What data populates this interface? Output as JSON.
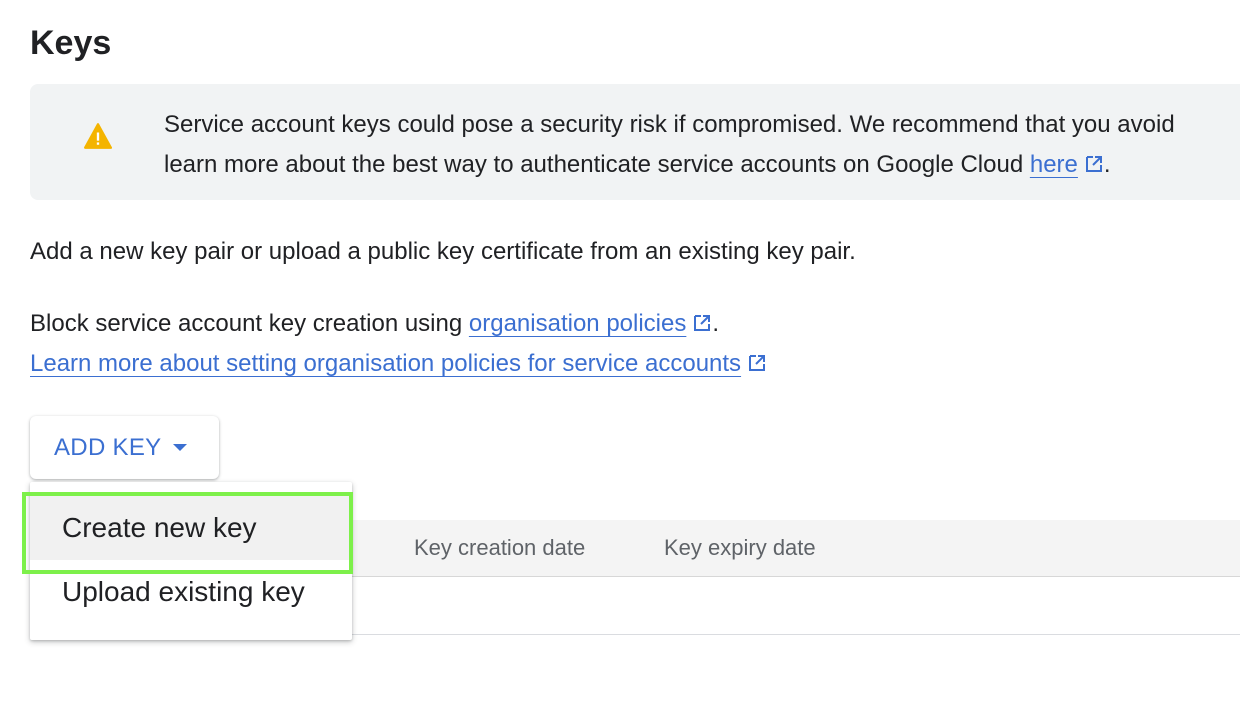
{
  "page": {
    "title": "Keys"
  },
  "warning": {
    "icon": "warning-icon",
    "icon_color": "#f4b400",
    "line1": "Service account keys could pose a security risk if compromised. We recommend that you avoid",
    "line2_prefix": "learn more about the best way to authenticate service accounts on Google Cloud ",
    "link_text": "here",
    "line2_suffix": "."
  },
  "description": "Add a new key pair or upload a public key certificate from an existing key pair.",
  "block": {
    "prefix": "Block service account key creation using ",
    "link_text": "organisation policies",
    "suffix": "."
  },
  "learn_more": {
    "link_text": "Learn more about setting organisation policies for service accounts"
  },
  "add_key": {
    "label": "ADD KEY"
  },
  "dropdown": {
    "items": [
      {
        "label": "Create new key"
      },
      {
        "label": "Upload existing key"
      }
    ]
  },
  "table": {
    "columns": [
      "Key creation date",
      "Key expiry date"
    ]
  },
  "colors": {
    "link": "#3b6fd1",
    "highlight": "#7df04a",
    "warning_bg": "#f1f3f4"
  }
}
